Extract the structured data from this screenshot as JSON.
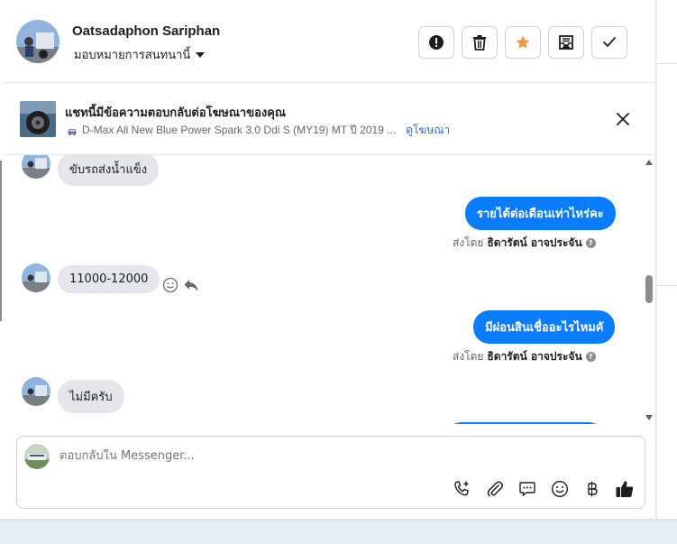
{
  "header": {
    "name": "Oatsadaphon Sariphan",
    "assign_label": "มอบหมายการสนทนานี้"
  },
  "ad": {
    "title": "แชทนี้มีข้อความตอบกลับต่อโฆษณาของคุณ",
    "car_name": "D-Max All New Blue Power Spark 3.0 Ddi S (MY19) MT ปี 2019 ...",
    "link": "ดูโฆษณา"
  },
  "messages": {
    "m1": "ขับรถส่งน้ำแข็ง",
    "m2": "รายได้ต่อเดือนเท่าไหร่คะ",
    "m2_sent_prefix": "ส่งโดย",
    "m2_sender": "ธิดารัตน์ อาจประจัน",
    "m3": "11000-12000",
    "m4": "มีผ่อนสินเชื่ออะไรไหมคั",
    "m4_sent_prefix": "ส่งโดย",
    "m4_sender": "ธิดารัตน์ อาจประจัน",
    "m5": "ไม่มีครับ"
  },
  "composer": {
    "placeholder": "ตอบกลับใน Messenger..."
  },
  "colors": {
    "accent": "#0a7cff",
    "star": "#f7923a",
    "link": "#216fdb"
  },
  "icons": {
    "alert": "alert-icon",
    "trash": "trash-icon",
    "star": "star-icon",
    "archive": "archive-icon",
    "check": "check-icon",
    "close": "close-icon",
    "phone": "phone-plus-icon",
    "attach": "paperclip-icon",
    "saved_reply": "speech-bubble-icon",
    "emoji": "emoji-icon",
    "baht": "baht-icon",
    "like": "thumbs-up-icon"
  }
}
